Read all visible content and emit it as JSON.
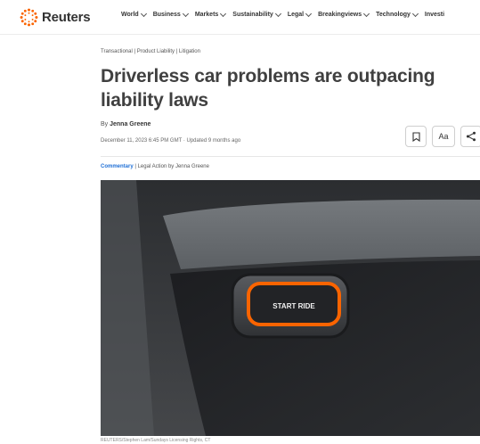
{
  "brand": {
    "name": "Reuters",
    "accent": "#fa6400"
  },
  "nav": [
    "World",
    "Business",
    "Markets",
    "Sustainability",
    "Legal",
    "Breakingviews",
    "Technology",
    "Investi"
  ],
  "article": {
    "breadcrumb": "Transactional | Product Liability | Litigation",
    "headline": "Driverless car problems are outpacing liability laws",
    "byline_prefix": "By ",
    "author": "Jenna Greene",
    "dateline": "December 11, 2023 6:45 PM GMT · Updated 9 months ago",
    "commentary_tag": "Commentary",
    "commentary_rest": " | Legal Action by Jenna Greene",
    "photo_button_label": "START RIDE",
    "caption": "REUTERS/Stephen Lam/Sundays Licensing Rights, CT"
  },
  "toolbar": {
    "text_size_label": "Aa"
  },
  "icons": {
    "bookmark": "bookmark-icon",
    "share": "share-icon",
    "logo": "reuters-logo-icon"
  }
}
